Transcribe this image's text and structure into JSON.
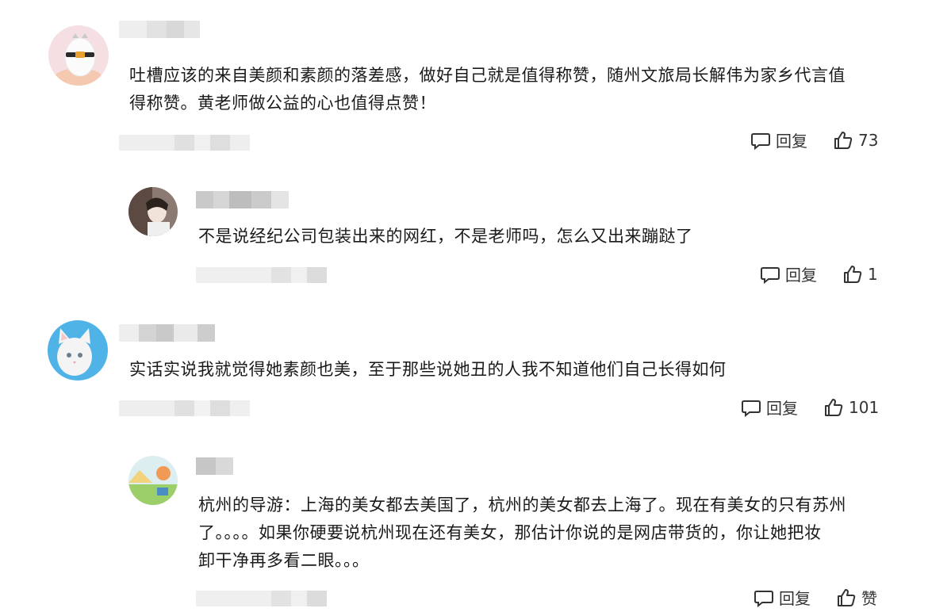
{
  "comments": [
    {
      "text_line1": "吐槽应该的来自美颜和素颜的落差感，做好自己就是值得称赞，随州文旅局长解伟为家乡代言值",
      "text_line2": "得称赞。黄老师做公益的心也值得点赞！",
      "reply_label": "回复",
      "like_count": "73",
      "avatar_icon": "cartoon-egg-avatar-icon"
    },
    {
      "text_line1": "不是说经纪公司包装出来的网红，不是老师吗，怎么又出来蹦跶了",
      "reply_label": "回复",
      "like_count": "1",
      "avatar_icon": "person-avatar-icon"
    },
    {
      "text_line1": "实话实说我就觉得她素颜也美，至于那些说她丑的人我不知道他们自己长得如何",
      "reply_label": "回复",
      "like_count": "101",
      "avatar_icon": "white-cat-avatar-icon"
    },
    {
      "text_line1": "杭州的导游：上海的美女都去美国了，杭州的美女都去上海了。现在有美女的只有苏州",
      "text_line2": "了。。。。如果你硬要说杭州现在还有美女，那估计你说的是网店带货的，你让她把妆",
      "text_line3": "卸干净再多看二眼。。。",
      "reply_label": "回复",
      "like_label": "赞",
      "avatar_icon": "landscape-avatar-icon"
    }
  ],
  "colors": {
    "text": "#1a1a1a",
    "blur_light": "#ebebeb",
    "blur_mid": "#dcdcdc",
    "blur_dark": "#cfcfcf",
    "icon": "#333333"
  }
}
